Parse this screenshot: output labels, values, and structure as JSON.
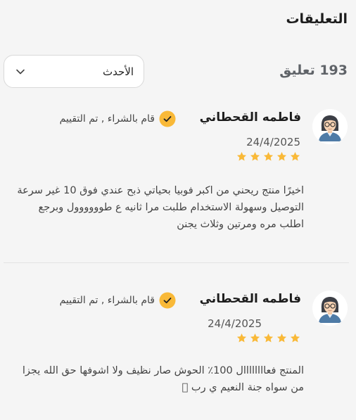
{
  "header": {
    "title": "التعليقات",
    "count_text": "193 تعليق"
  },
  "sort": {
    "selected": "الأحدث",
    "icon": "chevron-down-icon"
  },
  "colors": {
    "accent_star": "#f9b938",
    "badge_fill": "#f9b938",
    "background": "#f5f5f5"
  },
  "reviews": [
    {
      "name": "فاطمه القحطاني",
      "badge": "قام بالشراء , تم التقييم",
      "date": "24/4/2025",
      "rating": 5,
      "text": "اخيرًا منتج ريحني من اكبر فوبيا بحياتي ذبح عندي فوق 10 غير سرعة التوصيل وسهولة الاستخدام طلبت مرا ثانيه ع طوووووول وبرجع اطلب مره ومرتين وثلاث يجنن"
    },
    {
      "name": "فاطمه القحطاني",
      "badge": "قام بالشراء , تم التقييم",
      "date": "24/4/2025",
      "rating": 5,
      "text": "المنتج فعاااااااال 100٪ الحوش صار نظيف ولا اشوفها حق الله يجزا من سواه جنة النعيم ي رب 🏻"
    }
  ]
}
